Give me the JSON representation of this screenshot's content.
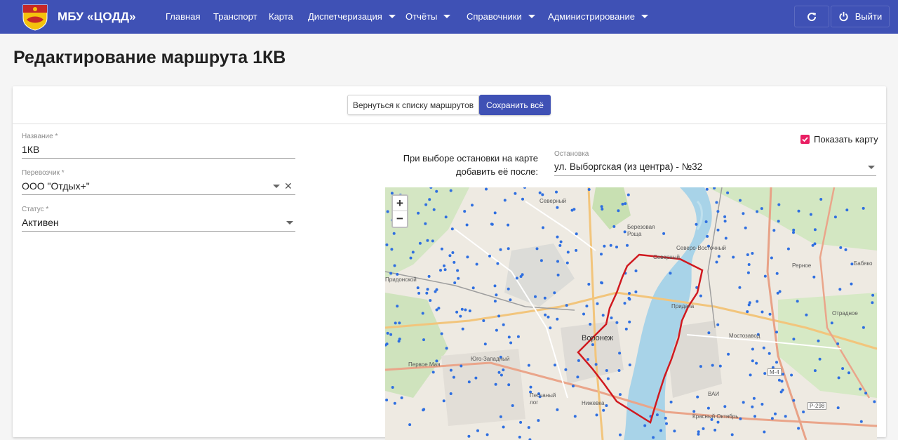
{
  "header": {
    "brand": "МБУ «ЦОДД»",
    "nav": [
      {
        "label": "Главная",
        "dropdown": false
      },
      {
        "label": "Транспорт",
        "dropdown": false
      },
      {
        "label": "Карта",
        "dropdown": false
      },
      {
        "label": "Диспетчеризация",
        "dropdown": true
      },
      {
        "label": "Отчёты",
        "dropdown": true
      },
      {
        "label": "Справочники",
        "dropdown": true
      },
      {
        "label": "Администрирование",
        "dropdown": true
      }
    ],
    "logout_label": "Выйти",
    "accent": "#3f51b5"
  },
  "page": {
    "title": "Редактирование маршрута 1КВ"
  },
  "actions": {
    "back_label": "Вернуться к списку маршрутов",
    "save_label": "Сохранить всё"
  },
  "form": {
    "name": {
      "label": "Название *",
      "value": "1КВ"
    },
    "carrier": {
      "label": "Перевозчик *",
      "value": "ООО \"Отдых+\""
    },
    "status": {
      "label": "Статус *",
      "value": "Активен"
    }
  },
  "map_panel": {
    "show_map_label": "Показать карту",
    "show_map_checked": true,
    "insert_hint_line1": "При выборе остановки на карте",
    "insert_hint_line2": "добавить её после:",
    "stop_label": "Остановка",
    "stop_value": "ул. Выборгская (из центра) - №32"
  },
  "map": {
    "zoom_in": "+",
    "zoom_out": "−",
    "route_color": "#d0191f",
    "stop_color": "#2f6fe0",
    "labels": [
      "Северный",
      "Березовая Роща",
      "Северо-Восточный",
      "Северный",
      "Придача",
      "Воронеж",
      "Мостозавод",
      "Отрадное",
      "Реpное",
      "Бабяко",
      "Юго-Западный",
      "Первое Мая",
      "Песчаный лог",
      "Нижевка",
      "ВАИ",
      "Красный Октябрь",
      "М-4",
      "Р-298",
      "Придонской"
    ]
  }
}
